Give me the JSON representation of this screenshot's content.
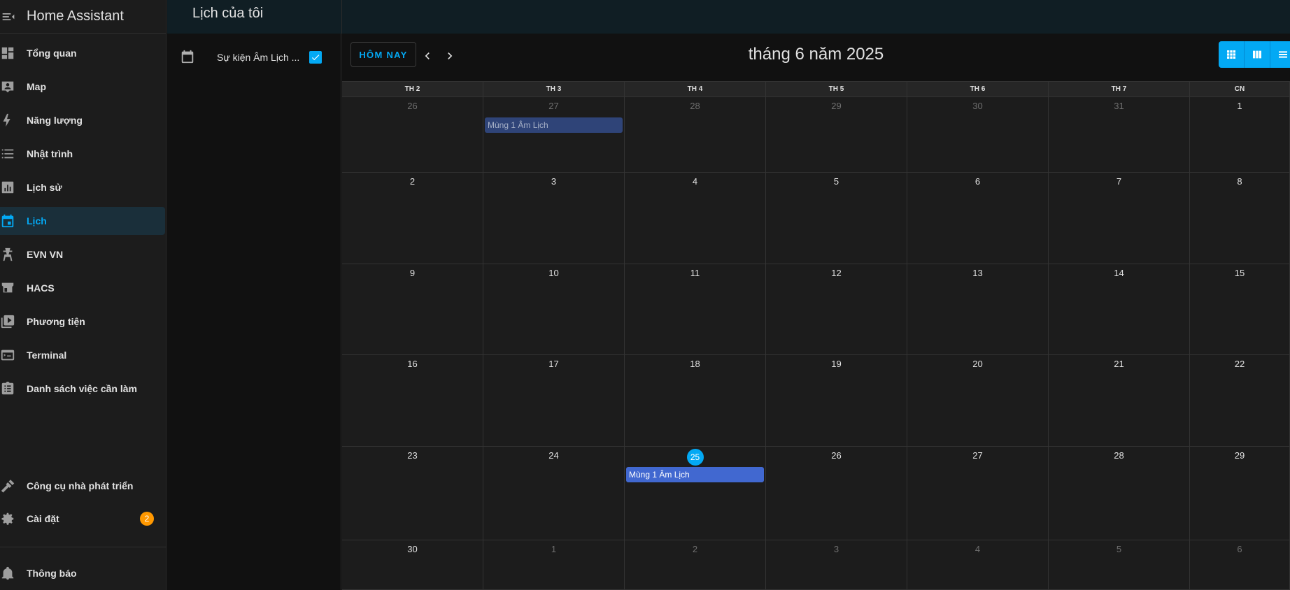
{
  "app": {
    "title": "Home Assistant"
  },
  "sidebar": {
    "items": [
      {
        "label": "Tổng quan",
        "icon": "dashboard-icon"
      },
      {
        "label": "Map",
        "icon": "map-account-icon"
      },
      {
        "label": "Năng lượng",
        "icon": "lightning-bolt-icon"
      },
      {
        "label": "Nhật trình",
        "icon": "format-list-icon"
      },
      {
        "label": "Lịch sử",
        "icon": "chart-box-icon"
      },
      {
        "label": "Lịch",
        "icon": "calendar-icon",
        "active": true
      },
      {
        "label": "EVN VN",
        "icon": "transmission-tower-icon"
      },
      {
        "label": "HACS",
        "icon": "hacs-store-icon"
      },
      {
        "label": "Phương tiện",
        "icon": "play-box-multiple-icon"
      },
      {
        "label": "Terminal",
        "icon": "console-icon"
      },
      {
        "label": "Danh sách việc cần làm",
        "icon": "clipboard-list-icon"
      }
    ],
    "developer_tools": "Công cụ nhà phát triển",
    "settings": "Cài đặt",
    "settings_badge": "2",
    "notifications": "Thông báo"
  },
  "page": {
    "title": "Lịch của tôi"
  },
  "calendars": [
    {
      "label": "Sự kiện Âm Lịch ...",
      "checked": true
    }
  ],
  "toolbar": {
    "today_label": "HÔM NAY",
    "month_title": "tháng 6 năm 2025",
    "views": [
      "month-view-icon",
      "week-view-icon",
      "list-view-icon"
    ]
  },
  "calendar": {
    "weekdays": [
      "TH 2",
      "TH 3",
      "TH 4",
      "TH 5",
      "TH 6",
      "TH 7",
      "CN"
    ],
    "weeks": [
      [
        {
          "d": "26",
          "o": true
        },
        {
          "d": "27",
          "o": true
        },
        {
          "d": "28",
          "o": true
        },
        {
          "d": "29",
          "o": true
        },
        {
          "d": "30",
          "o": true
        },
        {
          "d": "31",
          "o": true
        },
        {
          "d": "1"
        }
      ],
      [
        {
          "d": "2"
        },
        {
          "d": "3"
        },
        {
          "d": "4"
        },
        {
          "d": "5"
        },
        {
          "d": "6"
        },
        {
          "d": "7"
        },
        {
          "d": "8"
        }
      ],
      [
        {
          "d": "9"
        },
        {
          "d": "10"
        },
        {
          "d": "11"
        },
        {
          "d": "12"
        },
        {
          "d": "13"
        },
        {
          "d": "14"
        },
        {
          "d": "15"
        }
      ],
      [
        {
          "d": "16"
        },
        {
          "d": "17"
        },
        {
          "d": "18"
        },
        {
          "d": "19"
        },
        {
          "d": "20"
        },
        {
          "d": "21"
        },
        {
          "d": "22"
        }
      ],
      [
        {
          "d": "23"
        },
        {
          "d": "24"
        },
        {
          "d": "25",
          "today": true
        },
        {
          "d": "26"
        },
        {
          "d": "27"
        },
        {
          "d": "28"
        },
        {
          "d": "29"
        }
      ],
      [
        {
          "d": "30"
        },
        {
          "d": "1",
          "o": true
        },
        {
          "d": "2",
          "o": true
        },
        {
          "d": "3",
          "o": true
        },
        {
          "d": "4",
          "o": true
        },
        {
          "d": "5",
          "o": true
        },
        {
          "d": "6",
          "o": true
        }
      ]
    ],
    "events": [
      {
        "week": 0,
        "day": 1,
        "title": "Mùng 1 Âm Lịch",
        "past": true
      },
      {
        "week": 4,
        "day": 2,
        "title": "Mùng 1 Âm Lịch",
        "past": false
      }
    ]
  },
  "colors": {
    "accent": "#03a9f4",
    "badge": "#ff9800",
    "event": "#4168d0",
    "event_past": "#2f4478"
  }
}
